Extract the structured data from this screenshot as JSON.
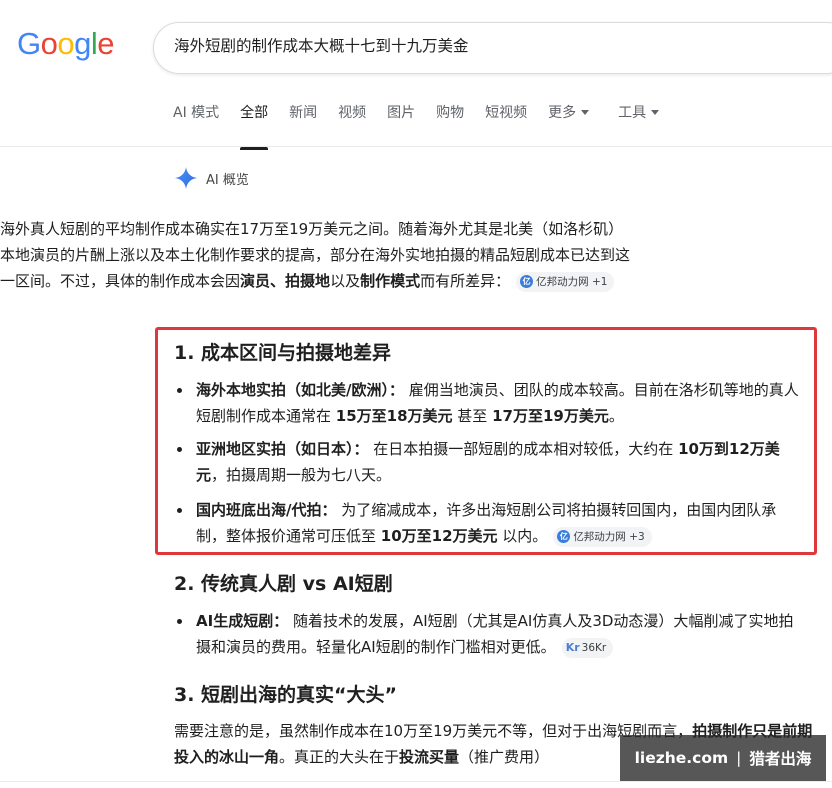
{
  "logo": {
    "letters": [
      "G",
      "o",
      "o",
      "g",
      "l",
      "e"
    ],
    "colors": [
      "#4285F4",
      "#EA4335",
      "#FBBC05",
      "#4285F4",
      "#34A853",
      "#EA4335"
    ]
  },
  "search": {
    "value": "海外短剧的制作成本大概十七到十九万美金"
  },
  "tabs": [
    {
      "label": "AI 模式"
    },
    {
      "label": "全部",
      "active": true
    },
    {
      "label": "新闻"
    },
    {
      "label": "视频"
    },
    {
      "label": "图片"
    },
    {
      "label": "购物"
    },
    {
      "label": "短视频"
    },
    {
      "label": "更多"
    },
    {
      "label": "工具"
    }
  ],
  "ai_overview": {
    "label": "AI 概览",
    "icon": "sparkle-icon",
    "accent_color": "#4285F4"
  },
  "intro": {
    "text1": "海外真人短剧的平均制作成本确实在17万至19万美元之间。随着海外尤其是北美（如洛杉矶）本地演员的片酬上涨以及本土化制作要求的提高，部分在海外实地拍摄的精品短剧成本已达到这一区间。不过，具体的制作成本会因",
    "b1": "演员",
    "sep1": "、",
    "b2": "拍摄地",
    "sep2": "以及",
    "b3": "制作模式",
    "text2": "而有所差异：",
    "chip": "亿邦动力网 +1"
  },
  "section1": {
    "heading": "1. 成本区间与拍摄地差异",
    "items": [
      {
        "title": "海外本地实拍（如北美/欧洲）：",
        "t1": " 雇佣当地演员、团队的成本较高。目前在洛杉矶等地的真人短剧制作成本通常在 ",
        "b1": "15万至18万美元",
        "t2": " 甚至 ",
        "b2": "17万至19万美元",
        "t3": "。"
      },
      {
        "title": "亚洲地区实拍（如日本）：",
        "t1": " 在日本拍摄一部短剧的成本相对较低，大约在 ",
        "b1": "10万到12万美元",
        "t2": "，拍摄周期一般为七八天。"
      },
      {
        "title": "国内班底出海/代拍：",
        "t1": " 为了缩减成本，许多出海短剧公司将拍摄转回国内，由国内团队承制，整体报价通常可压低至 ",
        "b1": "10万至12万美元",
        "t2": " 以内。",
        "chip": "亿邦动力网 +3"
      }
    ]
  },
  "section2": {
    "heading": "2. 传统真人剧 vs AI短剧",
    "item": {
      "title": "AI生成短剧：",
      "t1": " 随着技术的发展，AI短剧（尤其是AI仿真人及3D动态漫）大幅削减了实地拍摄和演员的费用。轻量化AI短剧的制作门槛相对更低。",
      "chip_icon": "Kr",
      "chip": "36Kr"
    }
  },
  "section3": {
    "heading": "3. 短剧出海的真实“大头”",
    "t1": "需要注意的是，虽然制作成本在10万至19万美元不等，但对于出海短剧而言，",
    "b1": "拍摄制作只是前期投入的冰山一角",
    "t2": "。真正的大头在于",
    "b2": "投流买量",
    "t3": "（推广费用）"
  },
  "watermark": {
    "site": "liezhe.com",
    "sep": "|",
    "name": "猎者出海"
  }
}
